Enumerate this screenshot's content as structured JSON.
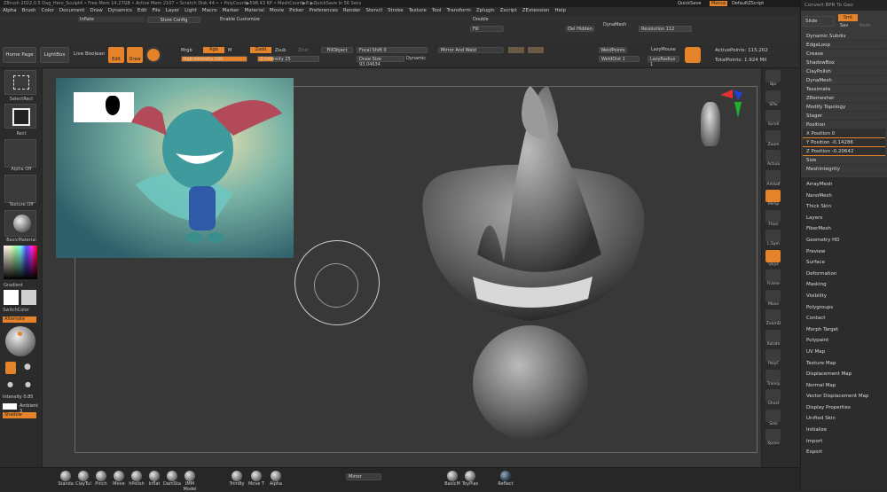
{
  "titlebar": {
    "text": "ZBrush 2022.0.5 Dag_Hero_Sculpt4   • Free Mem 14.27GB • Active Mem 2107 • Scratch Disk 44 • • PolyCount▶598.43 KP • MeshCount▶8 ▶QuickSave In 56 Secs"
  },
  "menu": [
    "Alpha",
    "Brush",
    "Color",
    "Document",
    "Draw",
    "Dynamics",
    "Edit",
    "File",
    "Layer",
    "Light",
    "Macro",
    "Marker",
    "Material",
    "Movie",
    "Picker",
    "Preferences",
    "Render",
    "Stencil",
    "Stroke",
    "Texture",
    "Tool",
    "Transform",
    "Zplugin",
    "Zscript",
    "ZExtension",
    "Help"
  ],
  "header_right": {
    "quicksave": "QuickSave",
    "menus": "Menus",
    "defaultscript": "DefaultZScript"
  },
  "toolbar": {
    "inflate_label": "Inflate",
    "store_config": "Store Config",
    "enable_customize": "Enable Customize",
    "double": "Double",
    "fill": "Fill",
    "del_hidden": "Del Hidden",
    "dynamesh": "DynaMesh",
    "resolution": "Resolution 112",
    "home_page": "Home Page",
    "lightbox": "LightBox",
    "live_boolean": "Live Boolean",
    "edit": "Edit",
    "draw": "Draw",
    "mrgb": "Mrgb",
    "rgb": "Rgb",
    "m": "M",
    "rgb_intensity": "Rgb Intensity 100",
    "zadd": "Zadd",
    "zsub": "Zsub",
    "zcut": "Zcut",
    "z_intensity": "Z Intensity 25",
    "fill_object": "FillObject",
    "focal_shift": "Focal Shift 0",
    "draw_size": "Draw Size 93.04634",
    "dynamic": "Dynamic",
    "mirror_weld": "Mirror And Weld",
    "weld_points": "WeldPoints",
    "weld_dist": "WeldDist 1",
    "lazymouse": "LazyMouse",
    "lazyradius": "LazyRadius 1",
    "active_points": "ActivePoints: 115,202",
    "total_points": "TotalPoints: 1.924 Mil",
    "z_intensity_value": 0.25,
    "rgb_intensity_value": 1.0
  },
  "left_shelf": {
    "select_rect": "SelectRect",
    "rect": "Rect",
    "alpha_off": "Alpha Off",
    "texture_off": "Texture Off",
    "basic_material": "BasicMaterial",
    "gradient": "Gradient",
    "switch_color": "SwitchColor",
    "alternate": "Alternate",
    "intensity": "Intensity 0.85",
    "ambient": "Ambient 3",
    "shadow": "Shadow"
  },
  "right_shelf": [
    "Bpr",
    "SPix",
    "Scroll",
    "Zoom",
    "Actual",
    "AAHalf",
    "Persp",
    "Floor",
    "L.Sym",
    "Qxyz",
    "Frame",
    "Move",
    "ZoomD",
    "Rotate",
    "PolyF",
    "Transp",
    "Ghost",
    "Solo",
    "Xpose"
  ],
  "right_panel": {
    "header": "Convert BPR To Geo",
    "tabs": [
      "Slide",
      "Smt",
      "Sav",
      "Redo"
    ],
    "submenu": [
      "Dynamic Subdiv",
      "EdgeLoop",
      "Crease",
      "ShadowBox",
      "ClayPolish",
      "DynaMesh",
      "Tessimate",
      "ZRemesher",
      "Modify Topology",
      "Stager",
      "Position",
      "X Position 0",
      "Y Position -0.14286",
      "Z Position -0.20642",
      "Size",
      "MeshIntegrity"
    ],
    "items": [
      "ArrayMesh",
      "NanoMesh",
      "Thick Skin",
      "Layers",
      "FiberMesh",
      "Geometry HD",
      "Preview",
      "Surface",
      "Deformation",
      "Masking",
      "Visibility",
      "Polygroups",
      "Contact",
      "Morph Target",
      "Polypaint",
      "UV Map",
      "Texture Map",
      "Displacement Map",
      "Normal Map",
      "Vector Displacement Map",
      "Display Properties",
      "Unified Skin",
      "Initialize",
      "Import",
      "Export"
    ]
  },
  "bottom_bar": {
    "brushes": [
      "Standa",
      "ClayTul",
      "Pinch",
      "Move",
      "hPolish",
      "Inflat",
      "DamSta",
      "IMM Model"
    ],
    "brushes2": [
      "TrimBy",
      "Move T",
      "Alpha"
    ],
    "mirror": "Mirror",
    "basicm": "BasicM",
    "toyplas": "ToyPlas",
    "reflect": "Reflect"
  },
  "colors": {
    "accent": "#e5832a",
    "panel": "#2c2c2c",
    "canvas": "#383838"
  }
}
